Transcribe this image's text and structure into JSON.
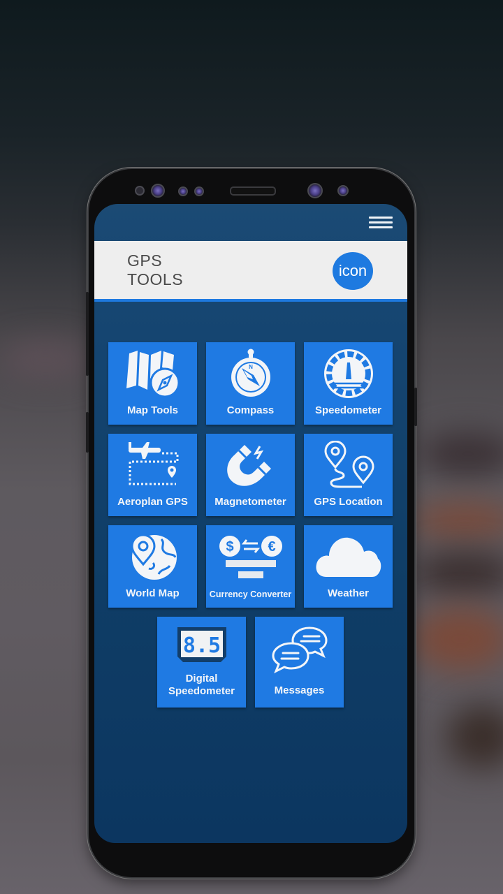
{
  "app": {
    "title_line1": "GPS",
    "title_line2": "TOOLS",
    "logo_text": "icon",
    "menu_icon": "hamburger-menu-icon"
  },
  "colors": {
    "accent": "#1f7ae3",
    "screen_bg": "#0f3d66",
    "header_bg": "#eeeeee",
    "title_text": "#4a4a4a"
  },
  "tiles": [
    {
      "label": "Map Tools",
      "icon": "map-tools-icon"
    },
    {
      "label": "Compass",
      "icon": "compass-icon"
    },
    {
      "label": "Speedometer",
      "icon": "speedometer-icon"
    },
    {
      "label": "Aeroplan GPS",
      "icon": "airplane-route-icon"
    },
    {
      "label": "Magnetometer",
      "icon": "magnet-icon"
    },
    {
      "label": "GPS Location",
      "icon": "location-route-icon"
    },
    {
      "label": "World Map",
      "icon": "world-map-icon"
    },
    {
      "label": "Currency Converter",
      "icon": "currency-exchange-icon"
    },
    {
      "label": "Weather",
      "icon": "cloud-icon"
    },
    {
      "label": "Digital Speedometer",
      "icon": "digital-display-icon",
      "display_value": "8.5"
    },
    {
      "label": "Messages",
      "icon": "chat-bubbles-icon"
    }
  ]
}
